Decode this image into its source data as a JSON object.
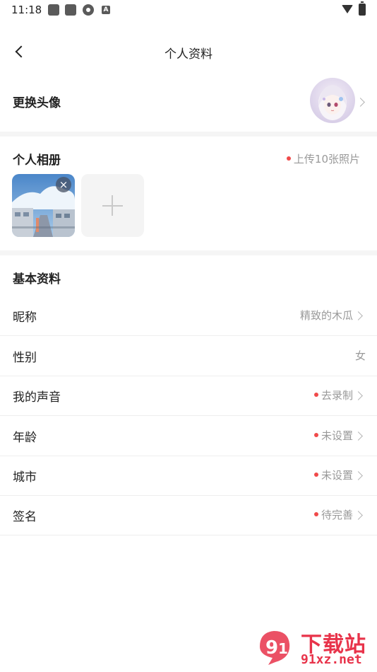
{
  "status_bar": {
    "time": "11:18",
    "icons": [
      "app-icon",
      "app-icon",
      "settings-icon",
      "a-icon"
    ],
    "right_icons": [
      "wifi-icon",
      "battery-icon"
    ]
  },
  "header": {
    "back_icon": "chevron-left-icon",
    "title": "个人资料"
  },
  "avatar_section": {
    "label": "更换头像"
  },
  "album": {
    "title": "个人相册",
    "hint": "上传10张照片",
    "delete_glyph": "×"
  },
  "basic": {
    "title": "基本资料",
    "rows": [
      {
        "label": "昵称",
        "value": "精致的木瓜"
      },
      {
        "label": "性别",
        "value": "女"
      },
      {
        "label": "我的声音",
        "value": "去录制"
      },
      {
        "label": "年龄",
        "value": "未设置"
      },
      {
        "label": "城市",
        "value": "未设置"
      },
      {
        "label": "签名",
        "value": "待完善"
      }
    ]
  },
  "watermark": {
    "text": "下载站",
    "url": "91xz.net"
  },
  "colors": {
    "accent_red": "#f04a4a",
    "watermark_red": "#e8334a",
    "muted_text": "#999999",
    "band": "#f5f5f5"
  }
}
